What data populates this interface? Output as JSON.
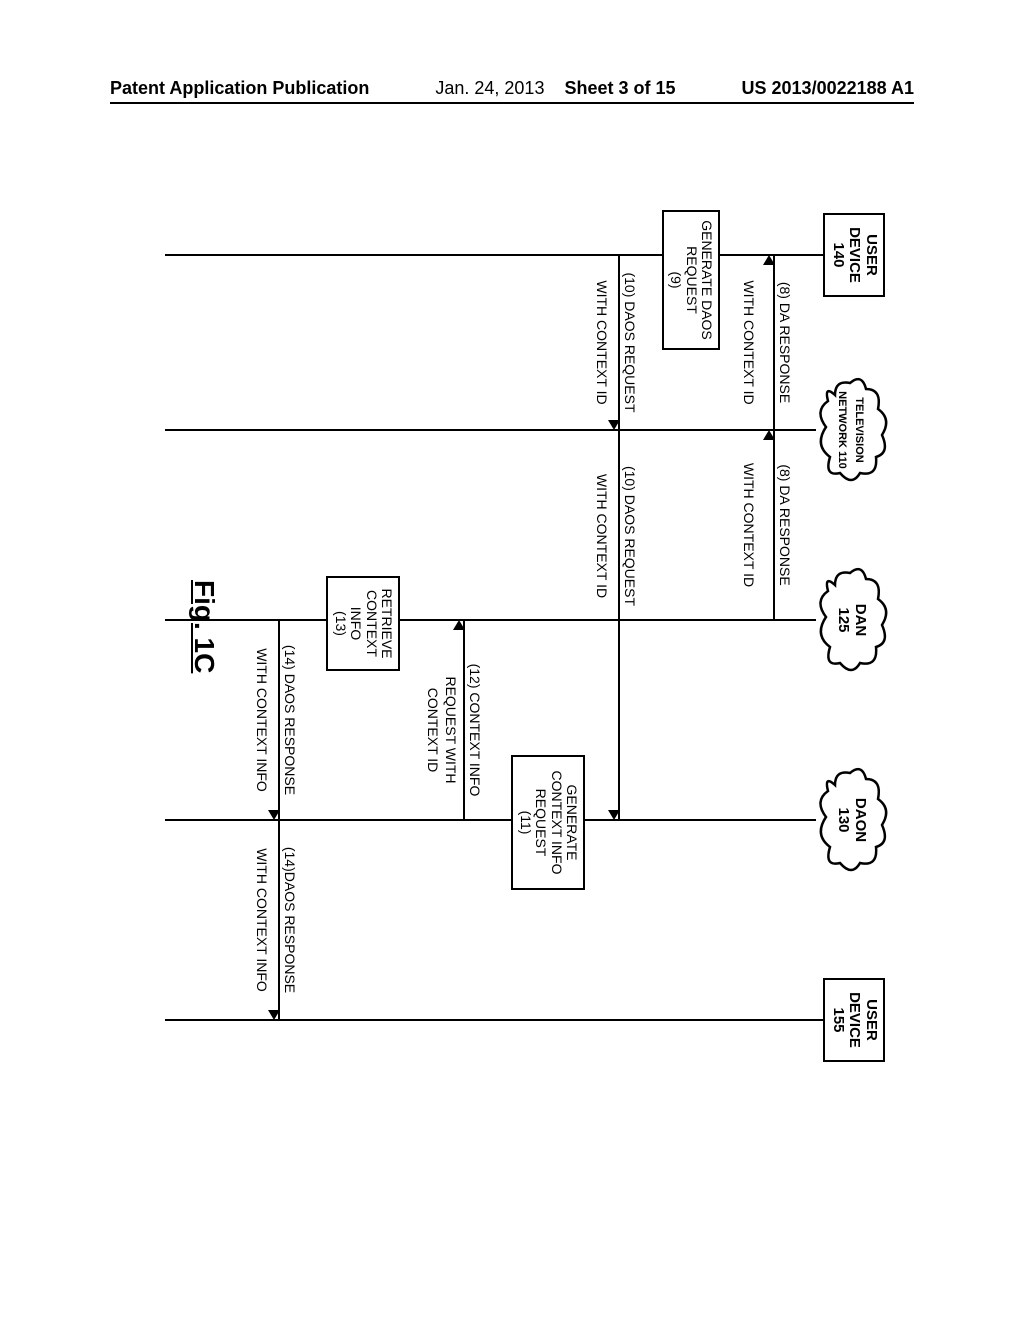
{
  "header": {
    "left": "Patent Application Publication",
    "date": "Jan. 24, 2013",
    "sheet": "Sheet 3 of 15",
    "docnum": "US 2013/0022188 A1"
  },
  "fig_caption": "Fig. 1C",
  "nodes": {
    "user_device_140": {
      "l1": "USER",
      "l2": "DEVICE",
      "l3": "140"
    },
    "tv_network_110": {
      "l1": "TELEVISION",
      "l2": "NETWORK 110"
    },
    "dan_125": {
      "l1": "DAN",
      "l2": "125"
    },
    "daon_130": {
      "l1": "DAON",
      "l2": "130"
    },
    "user_device_155": {
      "l1": "USER",
      "l2": "DEVICE",
      "l3": "155"
    }
  },
  "msgs": {
    "m8a_top": "(8)  DA RESPONSE",
    "m8a_bot": "WITH CONTEXT ID",
    "m8b_top": "(8)  DA RESPONSE",
    "m8b_bot": "WITH CONTEXT ID",
    "m10a_top": "(10) DAOS REQUEST",
    "m10a_bot": "WITH CONTEXT ID",
    "m10b_top": "(10)  DAOS REQUEST",
    "m10b_bot": "WITH CONTEXT ID",
    "m12_top": "(12) CONTEXT INFO",
    "m12_mid": "REQUEST WITH",
    "m12_bot": "CONTEXT ID",
    "m14a_top": "(14) DAOS RESPONSE",
    "m14a_bot": "WITH CONTEXT INFO",
    "m14b_top": "(14)DAOS RESPONSE",
    "m14b_bot": "WITH CONTEXT INFO"
  },
  "procs": {
    "p9_l1": "GENERATE DAOS",
    "p9_l2": "REQUEST",
    "p9_l3": "(9)",
    "p11_l1": "GENERATE",
    "p11_l2": "CONTEXT INFO",
    "p11_l3": "REQUEST",
    "p11_l4": "(11)",
    "p13_l1": "RETRIEVE",
    "p13_l2": "CONTEXT",
    "p13_l3": "INFO",
    "p13_l4": "(13)"
  }
}
